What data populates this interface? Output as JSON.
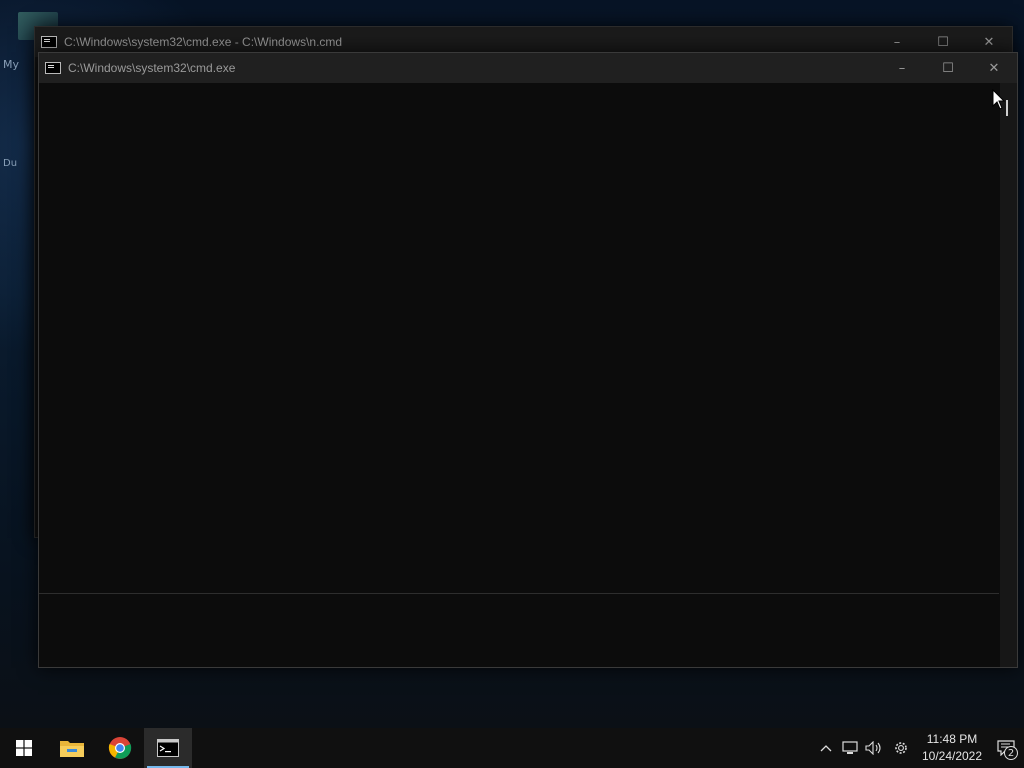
{
  "desktop": {
    "labels": [
      "My",
      "Du"
    ]
  },
  "back_window": {
    "title": "C:\\Windows\\system32\\cmd.exe - C:\\Windows\\n.cmd",
    "controls": {
      "minimize": "–",
      "maximize": "☐",
      "close": "✕"
    }
  },
  "front_window": {
    "title": "C:\\Windows\\system32\\cmd.exe",
    "controls": {
      "minimize": "–",
      "maximize": "☐",
      "close": "✕"
    }
  },
  "taskbar": {
    "apps": [
      {
        "name": "start",
        "icon": "windows-logo-icon"
      },
      {
        "name": "file-explorer",
        "icon": "folder-icon"
      },
      {
        "name": "chrome",
        "icon": "chrome-icon"
      },
      {
        "name": "command-prompt",
        "icon": "cmd-icon",
        "active": true
      }
    ],
    "tray": {
      "chevron": "^",
      "network_icon": "network-icon",
      "volume_icon": "volume-icon",
      "settings_icon": "gear-icon",
      "time": "11:48 PM",
      "date": "10/24/2022",
      "notification_count": "2"
    }
  }
}
